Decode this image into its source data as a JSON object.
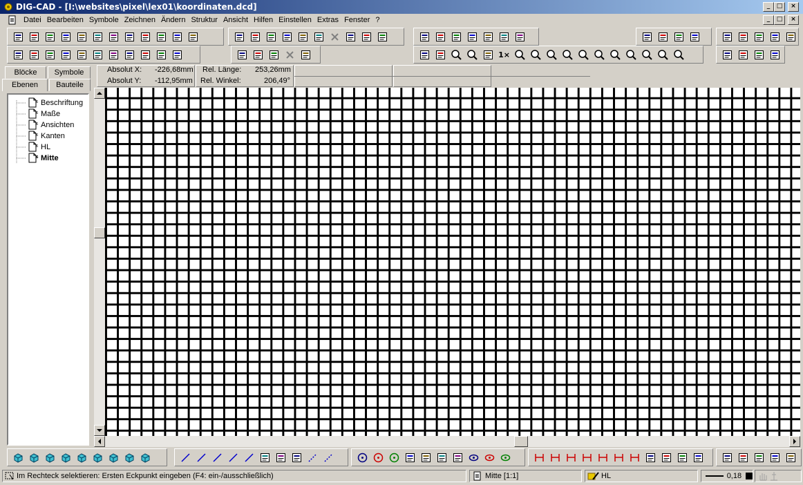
{
  "window": {
    "title": "DIG-CAD - [I:\\websites\\pixel\\lex01\\koordinaten.dcd]",
    "controls": {
      "minimize": "_",
      "maximize": "□",
      "close": "×"
    }
  },
  "menu": {
    "items": [
      "Datei",
      "Bearbeiten",
      "Symbole",
      "Zeichnen",
      "Ändern",
      "Struktur",
      "Ansicht",
      "Hilfen",
      "Einstellen",
      "Extras",
      "Fenster",
      "?"
    ]
  },
  "toolbar_row1": {
    "group1": [
      "new-file-icon",
      "open-folder-icon",
      "open-folder-2-icon",
      "save-disk-icon",
      "save-all-icon",
      "copy-window-icon",
      "book-icon",
      "open-doc-icon",
      "mail-icon",
      "print-preview-icon",
      "print-preview-2-icon",
      "printer-icon"
    ],
    "group2": [
      "cut-icon",
      "copy-icon",
      "paste-icon",
      "paste-special-icon",
      "undo-icon",
      "redo-icon",
      "cancel-icon",
      "confirm-icon",
      "snap-window-icon",
      "snap-window-2-icon"
    ],
    "group3": [
      "crosshair-icon",
      "measure-icon",
      "grid-dots-icon",
      "angle-icon",
      "angle-2-icon",
      "layers-copy-icon",
      "plugin-icon"
    ],
    "group4": [
      "eraser-icon",
      "eraser-2-icon",
      "pen-icon",
      "pen-2-icon"
    ],
    "group5": [
      "color-fill-icon",
      "cube-red-icon",
      "chart-icon",
      "cursor-icon",
      "cross-move-icon"
    ]
  },
  "toolbar_row2": {
    "group1": [
      "table-insert-icon",
      "window-split-icon",
      "window-split-2-icon",
      "arrow-right-icon",
      "arrow-left-icon",
      "table-grid-icon",
      "table-rows-icon",
      "table-cols-icon",
      "table-move-icon",
      "table-swap-icon",
      "table-swap-2-icon"
    ],
    "group2": [
      "image-edit-icon",
      "image-frame-icon",
      "image-select-icon",
      "close-x-icon",
      "point-label-icon"
    ],
    "group3": [
      "pencil-icon",
      "pencil-2-icon",
      "zoom-fit-icon",
      "zoom-window-icon",
      "pan-icon",
      "zoom-1x-label",
      "zoom-in-icon",
      "zoom-out-icon",
      "zoom-1-icon",
      "zoom-2-icon",
      "zoom-3-icon",
      "zoom-4-icon",
      "zoom-5-icon",
      "zoom-6-icon",
      "zoom-7-icon",
      "zoom-8-icon",
      "zoom-all-icon"
    ],
    "group4": [
      "properties-icon",
      "brush-icon",
      "text-style-icon",
      "palette-icon"
    ],
    "zoom_label": "1×"
  },
  "sidebar": {
    "tabs": [
      "Blöcke",
      "Symbole",
      "Ebenen",
      "Bauteile"
    ],
    "active_tab": "Ebenen",
    "layers": [
      {
        "label": "Beschriftung",
        "bold": false
      },
      {
        "label": "Maße",
        "bold": false
      },
      {
        "label": "Ansichten",
        "bold": false
      },
      {
        "label": "Kanten",
        "bold": false
      },
      {
        "label": "HL",
        "bold": false
      },
      {
        "label": "Mitte",
        "bold": true
      }
    ]
  },
  "coords": {
    "abs_x_label": "Absolut X:",
    "abs_x_value": "-226,68mm",
    "abs_y_label": "Absolut Y:",
    "abs_y_value": "-112,95mm",
    "rel_len_label": "Rel. Länge:",
    "rel_len_value": "253,26mm",
    "rel_ang_label": "Rel. Winkel:",
    "rel_ang_value": "206,49°"
  },
  "bottom_toolbar": {
    "groups": [
      [
        "block-1-icon",
        "block-2-icon",
        "block-3-icon",
        "block-4-icon",
        "block-5-icon",
        "block-6-icon",
        "block-7-icon",
        "block-8-icon",
        "block-9-icon"
      ],
      [
        "line-icon",
        "line-2-icon",
        "line-cross-icon",
        "parallel-icon",
        "parallel-2-icon",
        "trim-icon",
        "offset-icon",
        "polyline-icon",
        "dashed-icon",
        "dashed-2-icon"
      ],
      [
        "circle-center-icon",
        "circle-icon",
        "circle-2-icon",
        "arc-icon",
        "arc-2-icon",
        "arc-3-icon",
        "arc-4-icon",
        "ellipse-icon",
        "ellipse-2-icon",
        "ellipse-3-icon"
      ],
      [
        "dimension-icon",
        "dimension-2-icon",
        "dimension-3-icon",
        "dimension-cross-icon",
        "hatch-icon",
        "hatch-2-icon",
        "hatch-3-icon",
        "frame-icon",
        "diameter-icon",
        "radius-icon",
        "arc-dimension-icon"
      ],
      [
        "symbol-1-icon",
        "symbol-2-icon",
        "symbol-3-icon",
        "slope-icon",
        "triangle-icon"
      ]
    ]
  },
  "status": {
    "message": "Im Rechteck selektieren: Ersten Eckpunkt eingeben (F4: ein-/ausschließlich)",
    "layer": "Mitte [1:1]",
    "pen": "HL",
    "line_width": "0,18"
  },
  "colors": {
    "title_start": "#0a246a",
    "title_end": "#a6caf0",
    "face": "#d4d0c8",
    "grid": "#000000",
    "accent_red": "#cc0000",
    "accent_blue": "#0000cc",
    "accent_green": "#008000"
  }
}
